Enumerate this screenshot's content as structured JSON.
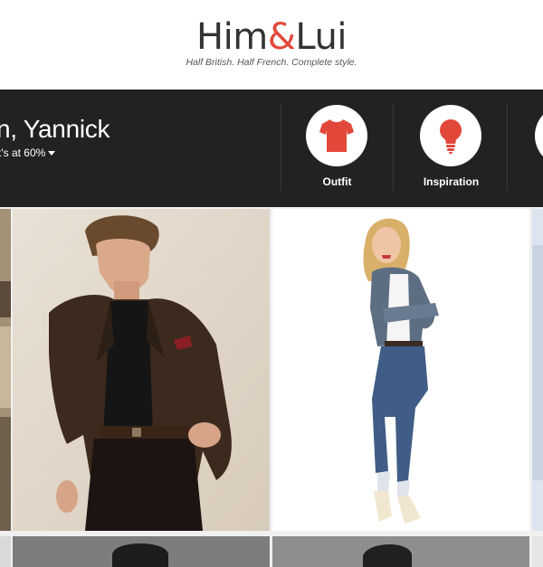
{
  "brand": {
    "name_part1": "Him",
    "name_amp": "&",
    "name_part2": "Lui",
    "tagline": "Half British. Half French. Complete style.",
    "accent": "#e2483a"
  },
  "topbar": {
    "greeting": "n, Yannick",
    "subline": "t's at 60%",
    "background": "#222222"
  },
  "nav": [
    {
      "label": "Outfit",
      "icon": "tshirt-icon"
    },
    {
      "label": "Inspiration",
      "icon": "lightbulb-icon"
    }
  ],
  "photos": [
    {
      "name": "photo-left-partial"
    },
    {
      "name": "photo-man-brown-blazer"
    },
    {
      "name": "photo-woman-denim"
    },
    {
      "name": "photo-right-partial"
    }
  ]
}
